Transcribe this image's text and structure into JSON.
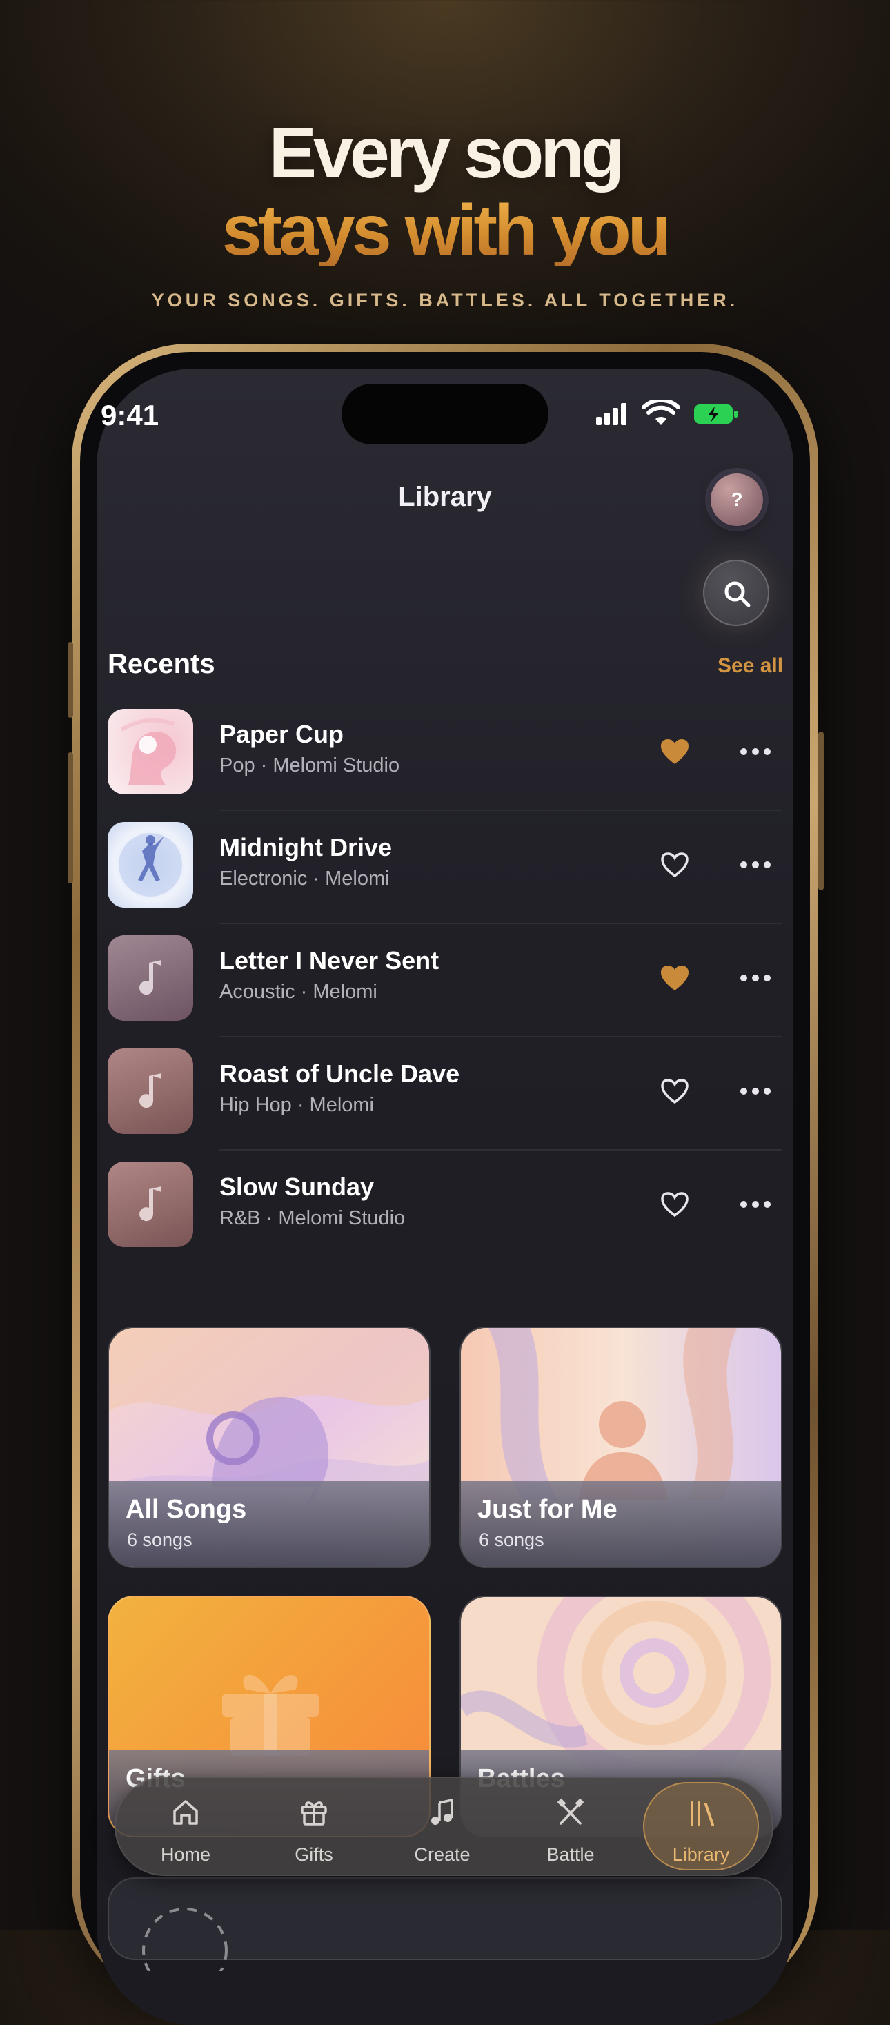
{
  "hero": {
    "line1": "Every song",
    "line2": "stays with you",
    "subtitle": "YOUR SONGS. GIFTS. BATTLES. ALL TOGETHER."
  },
  "status_bar": {
    "time": "9:41"
  },
  "header": {
    "title": "Library",
    "help_label": "?"
  },
  "recents": {
    "heading": "Recents",
    "see_all": "See all",
    "items": [
      {
        "name": "Paper Cup",
        "meta": "Pop · Melomi Studio",
        "liked": true,
        "art": "headphones-girl-art"
      },
      {
        "name": "Midnight Drive",
        "meta": "Electronic · Melomi",
        "liked": false,
        "art": "dancer-art"
      },
      {
        "name": "Letter I Never Sent",
        "meta": "Acoustic · Melomi",
        "liked": true,
        "art": "music-note-icon"
      },
      {
        "name": "Roast of Uncle Dave",
        "meta": "Hip Hop · Melomi",
        "liked": false,
        "art": "music-note-icon"
      },
      {
        "name": "Slow Sunday",
        "meta": "R&B · Melomi Studio",
        "liked": false,
        "art": "music-note-icon"
      }
    ]
  },
  "collections": [
    {
      "title": "All Songs",
      "subtitle": "6 songs"
    },
    {
      "title": "Just for Me",
      "subtitle": "6 songs"
    },
    {
      "title": "Gifts",
      "subtitle": ""
    },
    {
      "title": "Battles",
      "subtitle": ""
    }
  ],
  "nav": {
    "items": [
      {
        "label": "Home",
        "icon": "home-icon"
      },
      {
        "label": "Gifts",
        "icon": "gift-icon"
      },
      {
        "label": "Create",
        "icon": "music-note-icon"
      },
      {
        "label": "Battle",
        "icon": "crossed-swords-icon"
      },
      {
        "label": "Library",
        "icon": "library-icon",
        "active": true
      }
    ]
  },
  "colors": {
    "accent": "#d39541",
    "liked_heart": "#c98a3a",
    "screen_bg": "#201f26"
  }
}
